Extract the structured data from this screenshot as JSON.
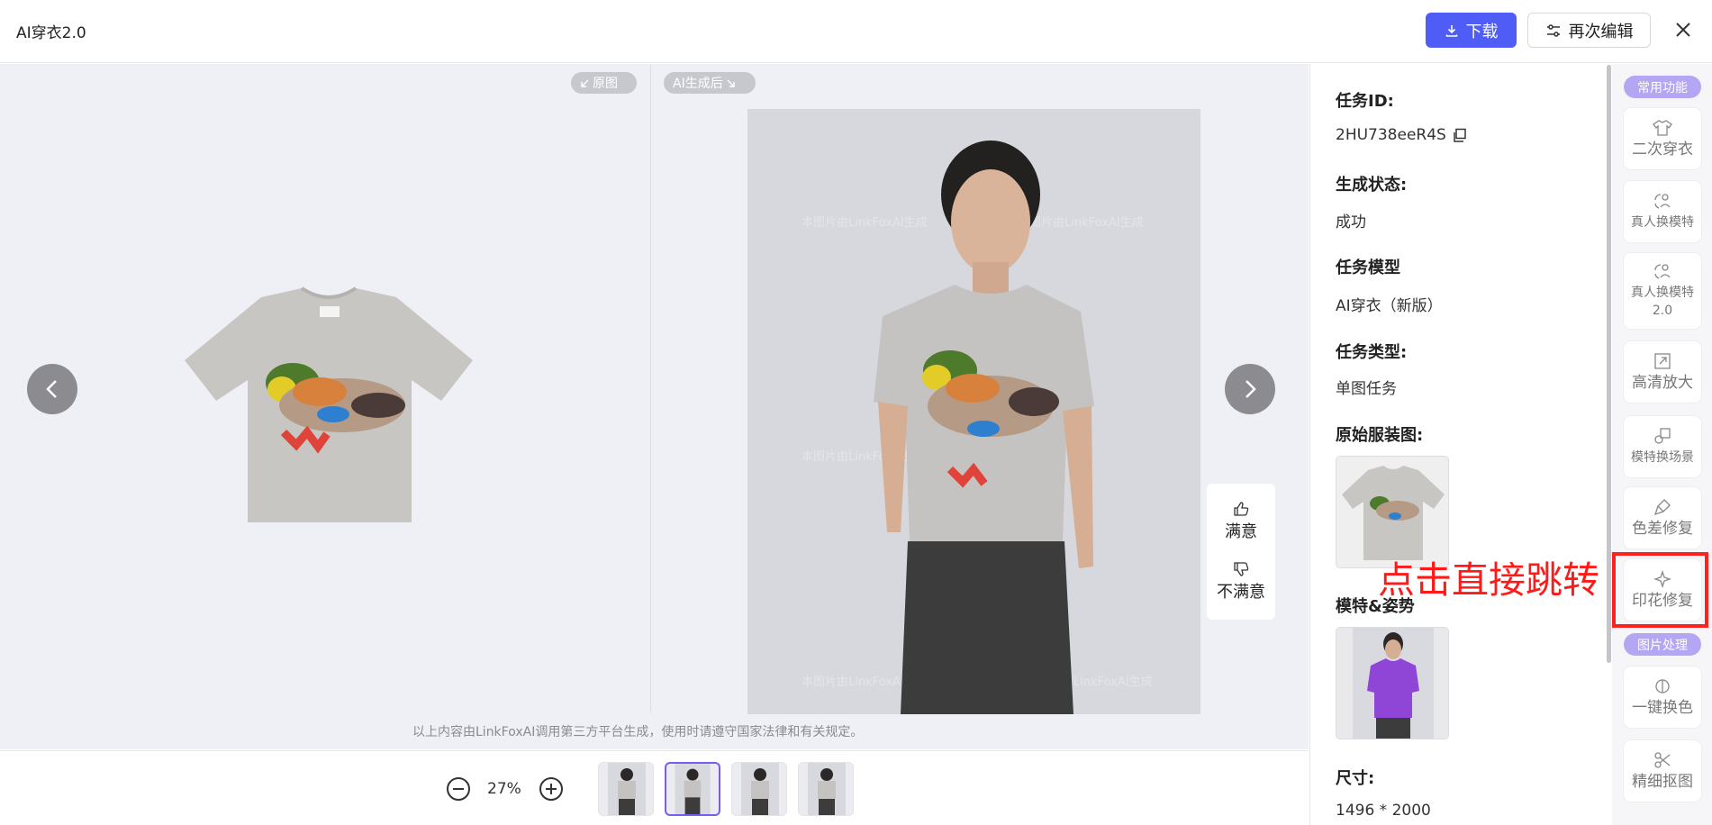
{
  "header": {
    "title": "AI穿衣2.0",
    "download_label": "下载",
    "reedit_label": "再次编辑",
    "close_icon": "close-icon"
  },
  "compare": {
    "original_tag": "原图",
    "ai_tag": "AI生成后",
    "disclaimer": "以上内容由LinkFoxAI调用第三方平台生成，使用时请遵守国家法律和有关规定。",
    "watermark": "本图片由LinkFoxAI生成"
  },
  "feedback": {
    "satisfied": "满意",
    "unsatisfied": "不满意"
  },
  "zoom": {
    "value": "27%"
  },
  "thumbnails": {
    "count": 4,
    "active_index": 1
  },
  "details": {
    "task_id_label": "任务ID:",
    "task_id_value": "2HU738eeR4S",
    "status_label": "生成状态:",
    "status_value": "成功",
    "model_label": "任务模型",
    "model_value": "AI穿衣（新版）",
    "type_label": "任务类型:",
    "type_value": "单图任务",
    "garment_label": "原始服装图:",
    "pose_label": "模特&姿势",
    "size_label": "尺寸:",
    "size_value": "1496 * 2000"
  },
  "toolbar": {
    "section_common": "常用功能",
    "section_image": "图片处理",
    "tools": [
      {
        "label": "二次穿衣",
        "icon": "shirt-icon"
      },
      {
        "label": "真人换模特",
        "icon": "swap-person-icon"
      },
      {
        "label": "真人换模特",
        "sub": "2.0",
        "icon": "swap-person-icon"
      },
      {
        "label": "高清放大",
        "icon": "upscale-icon"
      },
      {
        "label": "模特换场景",
        "icon": "scene-icon"
      },
      {
        "label": "色差修复",
        "icon": "brush-icon"
      },
      {
        "label": "印花修复",
        "icon": "sparkle-icon"
      },
      {
        "label": "一键换色",
        "icon": "color-swap-icon"
      },
      {
        "label": "精细抠图",
        "icon": "cutout-icon"
      }
    ]
  },
  "annotation": {
    "text": "点击直接跳转"
  },
  "colors": {
    "primary": "#4f5cf5",
    "accent_purple": "#b5a6f3",
    "highlight_red": "#ff2020"
  }
}
